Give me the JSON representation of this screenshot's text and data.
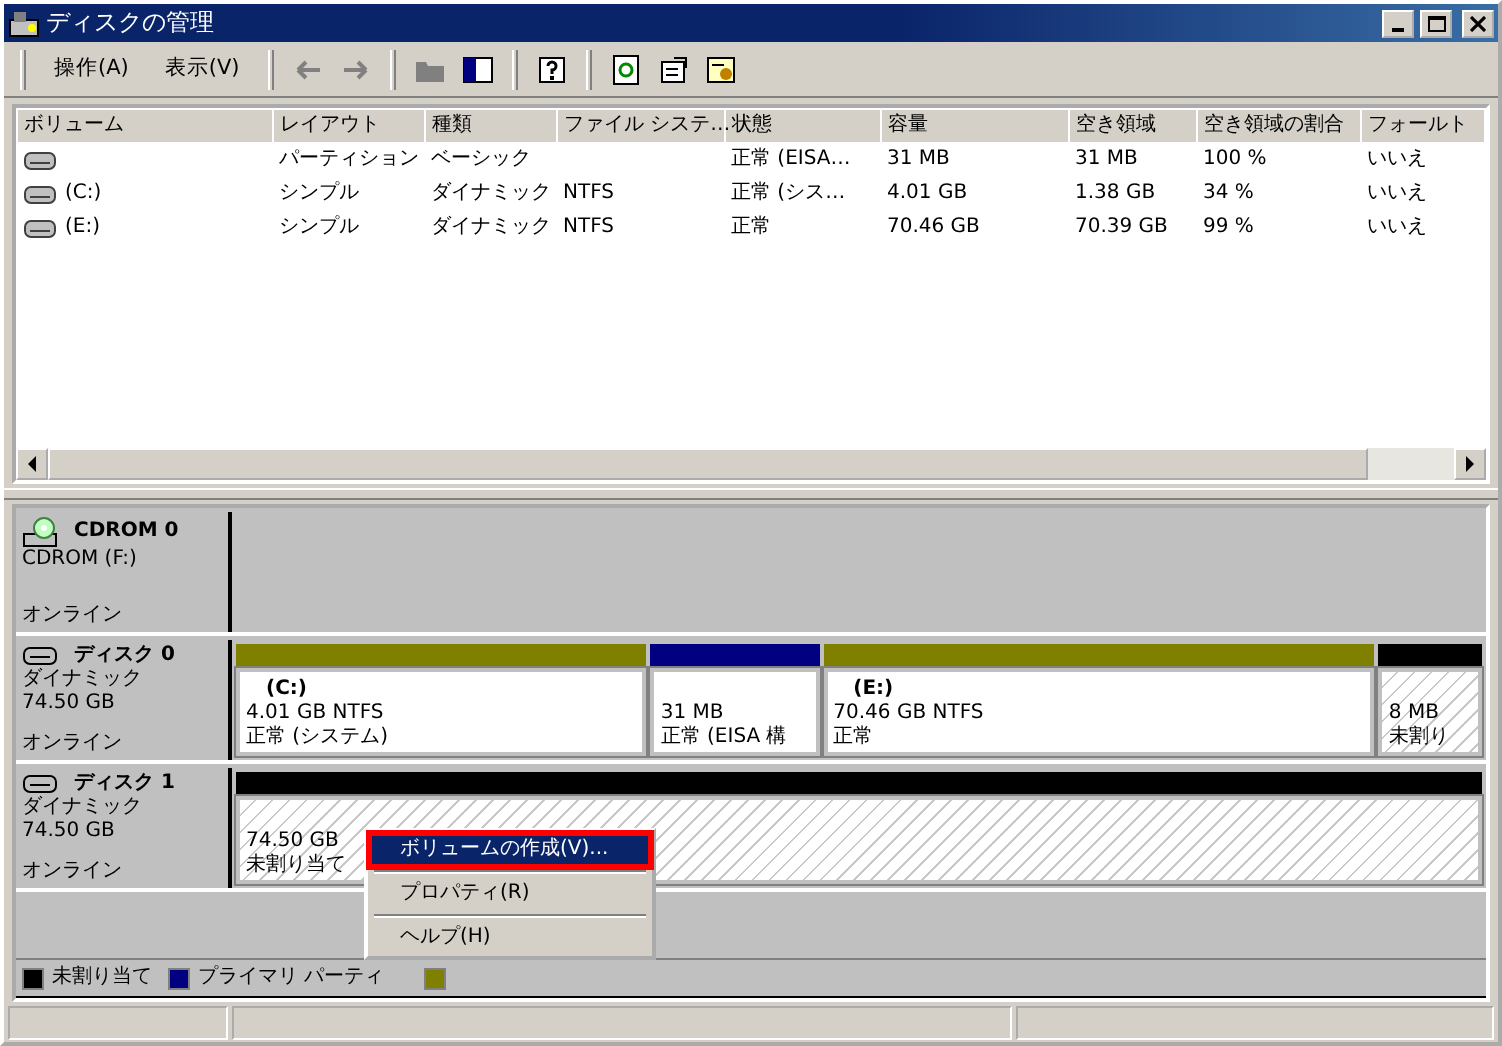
{
  "window": {
    "title": "ディスクの管理"
  },
  "menu": [
    {
      "label": "操作(A)"
    },
    {
      "label": "表示(V)"
    }
  ],
  "toolbar": [
    {
      "kind": "back",
      "disabled": true
    },
    {
      "kind": "forward",
      "disabled": true
    },
    {
      "kind": "sep"
    },
    {
      "kind": "up",
      "disabled": true
    },
    {
      "kind": "tree",
      "disabled": false
    },
    {
      "kind": "sep"
    },
    {
      "kind": "help",
      "disabled": false
    },
    {
      "kind": "sep"
    },
    {
      "kind": "refresh",
      "disabled": false
    },
    {
      "kind": "props",
      "disabled": false
    },
    {
      "kind": "settings",
      "disabled": false
    }
  ],
  "table": {
    "columns": [
      "ボリューム",
      "レイアウト",
      "種類",
      "ファイル システ…",
      "状態",
      "容量",
      "空き領域",
      "空き領域の割合",
      "フォールト"
    ],
    "rows": [
      {
        "cells": [
          "",
          "パーティション",
          "ベーシック",
          "",
          "正常 (EISA…",
          "31 MB",
          "31 MB",
          "100 %",
          "いいえ"
        ]
      },
      {
        "cells": [
          "(C:)",
          "シンプル",
          "ダイナミック",
          "NTFS",
          "正常 (シス…",
          "4.01 GB",
          "1.38 GB",
          "34 %",
          "いいえ"
        ]
      },
      {
        "cells": [
          "(E:)",
          "シンプル",
          "ダイナミック",
          "NTFS",
          "正常",
          "70.46 GB",
          "70.39 GB",
          "99 %",
          "いいえ"
        ]
      }
    ]
  },
  "disks": [
    {
      "kind": "cdrom",
      "name": "CDROM 0",
      "lines": [
        "CDROM (F:)"
      ],
      "status": "オンライン"
    },
    {
      "kind": "disk",
      "name": "ディスク 0",
      "lines": [
        "ダイナミック",
        "74.50 GB"
      ],
      "status": "オンライン",
      "partitions": [
        {
          "kind": "simple",
          "title": "(C:)",
          "lines": [
            "4.01 GB NTFS",
            "正常 (システム)"
          ]
        },
        {
          "kind": "primary",
          "lines": [
            "31 MB",
            "正常 (EISA 構"
          ]
        },
        {
          "kind": "simple",
          "title": "(E:)",
          "lines": [
            "70.46 GB NTFS",
            "正常"
          ]
        },
        {
          "kind": "unallocated",
          "lines": [
            "8 MB",
            "未割り"
          ]
        }
      ]
    },
    {
      "kind": "disk",
      "name": "ディスク 1",
      "lines": [
        "ダイナミック",
        "74.50 GB"
      ],
      "status": "オンライン",
      "partitions": [
        {
          "kind": "unallocated",
          "lines": [
            "74.50 GB",
            "未割り当て"
          ]
        }
      ]
    }
  ],
  "legend": [
    {
      "label": "未割り当て",
      "color": "#000000"
    },
    {
      "label": "プライマリ パーティ",
      "color": "#000080"
    },
    {
      "color": "#808000"
    }
  ],
  "context_menu": [
    {
      "kind": "item",
      "label": "ボリュームの作成(V)...",
      "selected": true,
      "annotated": true
    },
    {
      "kind": "separator"
    },
    {
      "kind": "item",
      "label": "プロパティ(R)",
      "selected": false,
      "annotated": false
    },
    {
      "kind": "separator"
    },
    {
      "kind": "item",
      "label": "ヘルプ(H)",
      "selected": false,
      "annotated": false
    }
  ]
}
